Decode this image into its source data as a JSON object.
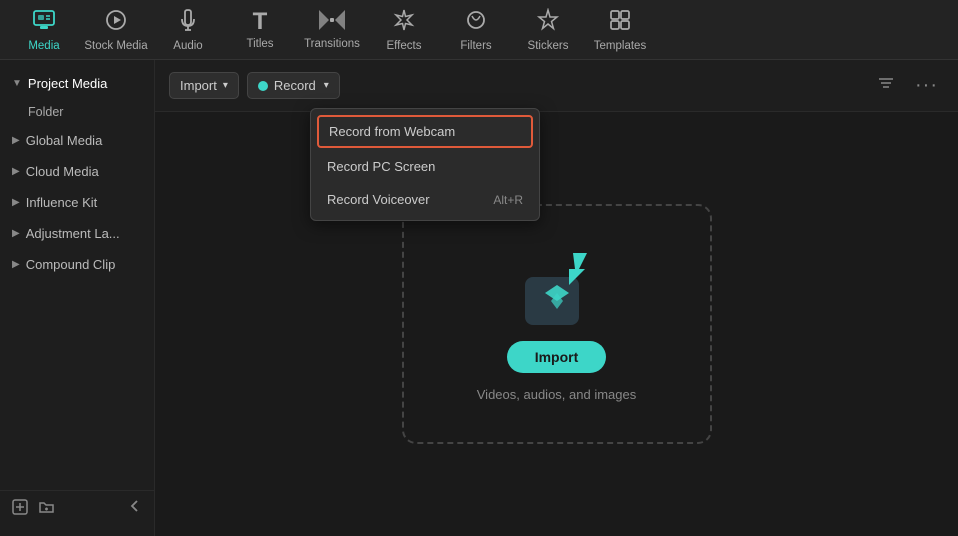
{
  "toolbar": {
    "items": [
      {
        "id": "media",
        "label": "Media",
        "icon": "⬛",
        "active": true
      },
      {
        "id": "stock-media",
        "label": "Stock Media",
        "icon": "🎬"
      },
      {
        "id": "audio",
        "label": "Audio",
        "icon": "♪"
      },
      {
        "id": "titles",
        "label": "Titles",
        "icon": "T"
      },
      {
        "id": "transitions",
        "label": "Transitions",
        "icon": "⟺"
      },
      {
        "id": "effects",
        "label": "Effects",
        "icon": "✦"
      },
      {
        "id": "filters",
        "label": "Filters",
        "icon": "◈"
      },
      {
        "id": "stickers",
        "label": "Stickers",
        "icon": "★"
      },
      {
        "id": "templates",
        "label": "Templates",
        "icon": "⊞"
      }
    ]
  },
  "sidebar": {
    "items": [
      {
        "id": "project-media",
        "label": "Project Media",
        "active": true,
        "expanded": true
      },
      {
        "id": "folder",
        "label": "Folder"
      },
      {
        "id": "global-media",
        "label": "Global Media",
        "active": false
      },
      {
        "id": "cloud-media",
        "label": "Cloud Media"
      },
      {
        "id": "influence-kit",
        "label": "Influence Kit"
      },
      {
        "id": "adjustment-la",
        "label": "Adjustment La..."
      },
      {
        "id": "compound-clip",
        "label": "Compound Clip"
      }
    ],
    "bottom_icons": [
      {
        "id": "add-folder",
        "icon": "⊞"
      },
      {
        "id": "new-folder",
        "icon": "📁"
      },
      {
        "id": "collapse",
        "icon": "◀"
      }
    ]
  },
  "header": {
    "import_label": "Import",
    "record_label": "Record",
    "filter_icon": "filter-icon",
    "more_icon": "more-icon"
  },
  "dropdown": {
    "items": [
      {
        "id": "record-webcam",
        "label": "Record from Webcam",
        "shortcut": "",
        "highlighted": true
      },
      {
        "id": "record-screen",
        "label": "Record PC Screen",
        "shortcut": ""
      },
      {
        "id": "record-voiceover",
        "label": "Record Voiceover",
        "shortcut": "Alt+R"
      }
    ]
  },
  "import_zone": {
    "button_label": "Import",
    "description": "Videos, audios, and images"
  }
}
